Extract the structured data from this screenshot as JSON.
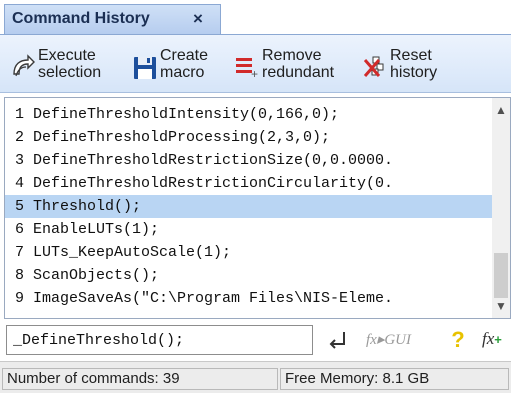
{
  "tab": {
    "title": "Command History",
    "close": "×"
  },
  "toolbar": {
    "execute": {
      "line1": "Execute",
      "line2": "selection",
      "icon": "execute-selection-icon"
    },
    "create": {
      "line1": "Create",
      "line2": "macro",
      "icon": "floppy-disk-icon"
    },
    "remove": {
      "line1": "Remove",
      "line2": "redundant",
      "icon": "remove-redundant-icon"
    },
    "reset": {
      "line1": "Reset",
      "line2": "history",
      "icon": "reset-history-icon"
    }
  },
  "commands": [
    "1 DefineThresholdIntensity(0,166,0);",
    "2 DefineThresholdProcessing(2,3,0);",
    "3 DefineThresholdRestrictionSize(0,0.0000.",
    "4 DefineThresholdRestrictionCircularity(0.",
    "5 Threshold();",
    "6 EnableLUTs(1);",
    "7 LUTs_KeepAutoScale(1);",
    "8 ScanObjects();",
    "9 ImageSaveAs(\"C:\\Program Files\\NIS-Eleme."
  ],
  "selected_index": 4,
  "input": {
    "value": "_DefineThreshold();"
  },
  "input_buttons": {
    "fx_gui": "fx▸GUI",
    "help": "?",
    "fx": "fx"
  },
  "status": {
    "commands": "Number of commands: 39",
    "memory": "Free Memory: 8.1 GB"
  },
  "colors": {
    "selection": "#b9d5f3",
    "tab": "#c3d7f3",
    "accent_red": "#d12a2a",
    "help_yellow": "#e8c200"
  }
}
